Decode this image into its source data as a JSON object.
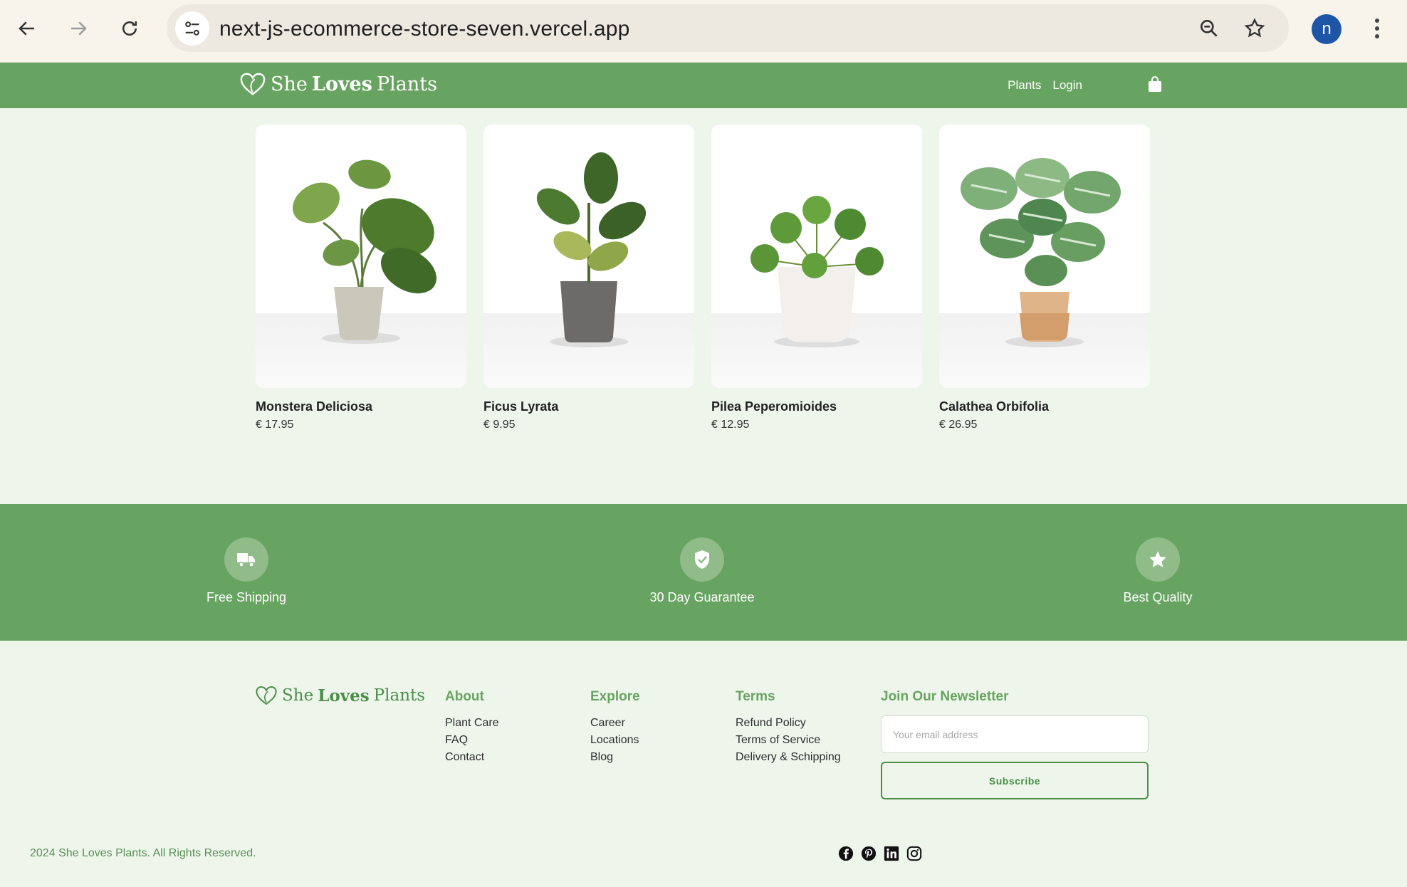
{
  "browser": {
    "url": "next-js-ecommerce-store-seven.vercel.app",
    "profile_initial": "n"
  },
  "header": {
    "brand_she": "She",
    "brand_loves": "Loves",
    "brand_plants": "Plants",
    "nav": [
      {
        "label": "Plants"
      },
      {
        "label": "Login"
      }
    ]
  },
  "products": [
    {
      "name": "Monstera Deliciosa",
      "price": "€ 17.95"
    },
    {
      "name": "Ficus Lyrata",
      "price": "€ 9.95"
    },
    {
      "name": "Pilea Peperomioides",
      "price": "€ 12.95"
    },
    {
      "name": "Calathea Orbifolia",
      "price": "€ 26.95"
    }
  ],
  "features": [
    {
      "label": "Free Shipping",
      "icon": "truck-icon"
    },
    {
      "label": "30 Day Guarantee",
      "icon": "shield-check-icon"
    },
    {
      "label": "Best Quality",
      "icon": "star-icon"
    }
  ],
  "footer": {
    "columns": [
      {
        "title": "About",
        "links": [
          "Plant Care",
          "FAQ",
          "Contact"
        ]
      },
      {
        "title": "Explore",
        "links": [
          "Career",
          "Locations",
          "Blog"
        ]
      },
      {
        "title": "Terms",
        "links": [
          "Refund Policy",
          "Terms of Service",
          "Delivery & Schipping"
        ]
      }
    ],
    "newsletter": {
      "title": "Join Our Newsletter",
      "placeholder": "Your email address",
      "button": "Subscribe"
    },
    "copyright": "2024 She Loves Plants. All Rights Reserved.",
    "socials": [
      "facebook-icon",
      "pinterest-icon",
      "linkedin-icon",
      "instagram-icon"
    ]
  },
  "colors": {
    "brand_green": "#68a461",
    "page_bg": "#eef6ec"
  }
}
